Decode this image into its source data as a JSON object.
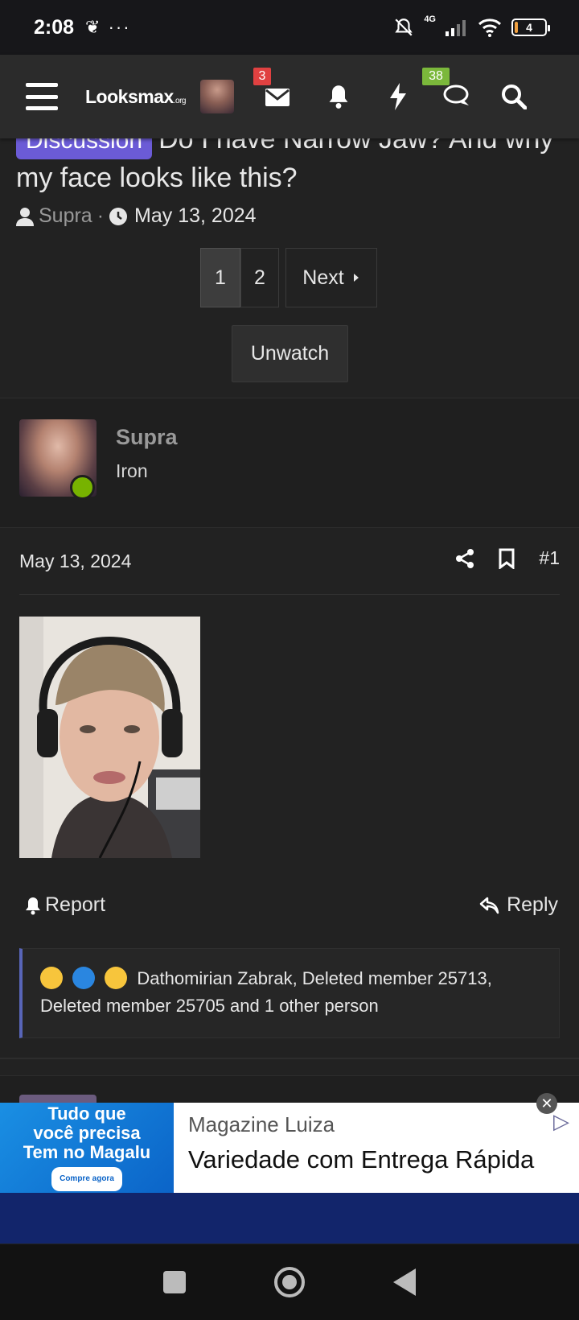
{
  "status_bar": {
    "time": "2:08",
    "left_icons": "❦ ···",
    "network": "4G",
    "battery": "4"
  },
  "header": {
    "logo": "Looksmax",
    "logo_suffix": ".org",
    "inbox_badge": "3",
    "conversations_badge": "38"
  },
  "thread": {
    "prefix": "Discussion",
    "title": "Do I have Narrow Jaw? And why my face looks like this?",
    "author": "Supra",
    "date": "May 13, 2024",
    "pages": [
      "1",
      "2"
    ],
    "next_label": "Next",
    "unwatch_label": "Unwatch"
  },
  "post": {
    "username": "Supra",
    "rank": "Iron",
    "date": "May 13, 2024",
    "number": "#1",
    "report_label": "Report",
    "reply_label": "Reply",
    "reactions_text": "Dathomirian Zabrak, Deleted member 25713, Deleted member 25705 and 1 other person"
  },
  "ad": {
    "image_lines": [
      "Tudo que",
      "você precisa",
      "Tem no Magalu"
    ],
    "image_cta": "Compre agora",
    "advertiser": "Magazine Luiza",
    "headline": "Variedade com Entrega Rápida"
  },
  "colors": {
    "background": "#222222",
    "header": "#2b2b2b",
    "prefix": "#6b5bd6",
    "online": "#77b300",
    "badge_red": "#e04141",
    "badge_green": "#7bb83b",
    "reaction_border": "#5865b8"
  }
}
